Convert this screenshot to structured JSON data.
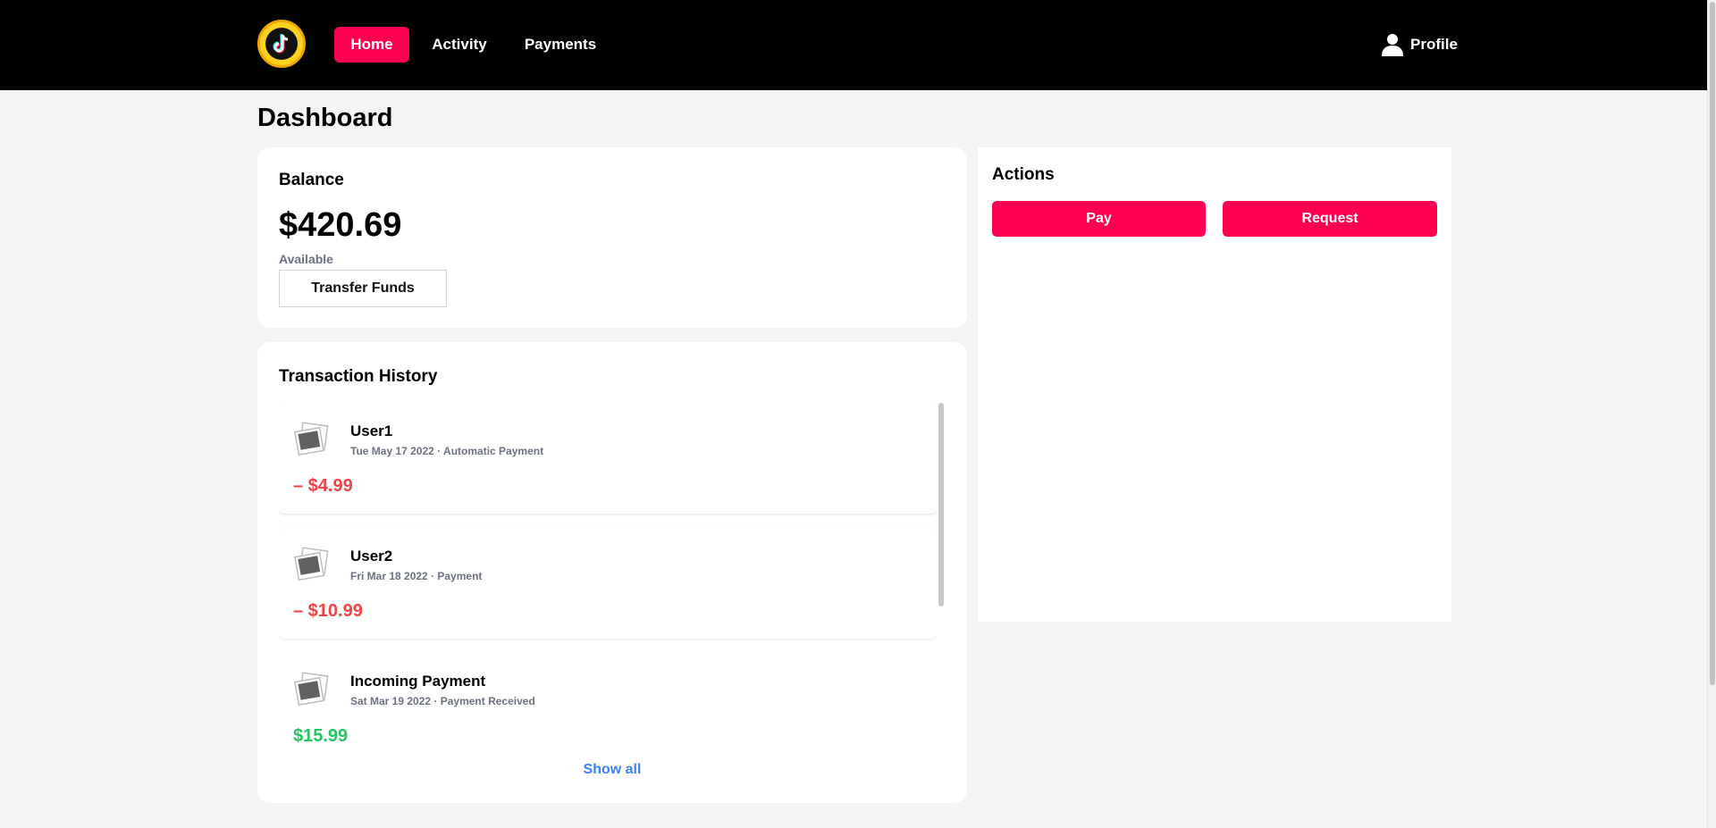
{
  "nav": {
    "items": [
      {
        "label": "Home",
        "active": true
      },
      {
        "label": "Activity",
        "active": false
      },
      {
        "label": "Payments",
        "active": false
      }
    ],
    "profile_label": "Profile",
    "accent_color": "#ff0050"
  },
  "page": {
    "title": "Dashboard"
  },
  "balance": {
    "title": "Balance",
    "amount": "$420.69",
    "label": "Available",
    "transfer_label": "Transfer Funds"
  },
  "history": {
    "title": "Transaction History",
    "transactions": [
      {
        "name": "User1",
        "meta": "Tue May 17 2022 · Automatic Payment",
        "amount": "– $4.99",
        "direction": "debit",
        "icon": "photo-placeholder-icon"
      },
      {
        "name": "User2",
        "meta": "Fri Mar 18 2022 · Payment",
        "amount": "– $10.99",
        "direction": "debit",
        "icon": "photo-placeholder-icon"
      },
      {
        "name": "Incoming Payment",
        "meta": "Sat Mar 19 2022 · Payment Received",
        "amount": "$15.99",
        "direction": "credit",
        "icon": "photo-placeholder-icon"
      }
    ],
    "show_all_label": "Show all"
  },
  "actions": {
    "title": "Actions",
    "pay_label": "Pay",
    "request_label": "Request"
  },
  "colors": {
    "debit": "#ef4444",
    "credit": "#22c55e",
    "link": "#3b82f6"
  }
}
